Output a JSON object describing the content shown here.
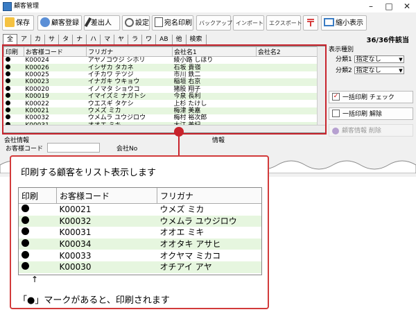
{
  "window": {
    "title": "顧客管理"
  },
  "toolbar": {
    "save": "保存",
    "register": "顧客登録",
    "sender": "差出人",
    "settings": "設定",
    "address_print": "宛名印刷",
    "backup": "バックアップ",
    "import": "インポート",
    "export": "エクスポート",
    "shrink": "縮小表示"
  },
  "kana_tabs": [
    "全",
    "ア",
    "カ",
    "サ",
    "タ",
    "ナ",
    "ハ",
    "マ",
    "ヤ",
    "ラ",
    "ワ",
    "AB",
    "他",
    "検索"
  ],
  "count_label": "36/36件該当",
  "grid": {
    "columns": [
      "印刷",
      "お客様コード",
      "フリガナ",
      "",
      "会社名1",
      "会社名2"
    ],
    "rows": [
      {
        "code": "K00024",
        "kana": "アヤノコウジ シホリ",
        "company": "綾小路 しほり"
      },
      {
        "code": "K00026",
        "kana": "イシザカ タカネ",
        "company": "石坂 貴嶺"
      },
      {
        "code": "K00025",
        "kana": "イチカワ テツジ",
        "company": "市川 鉄二"
      },
      {
        "code": "K00023",
        "kana": "イナガキ ウキョウ",
        "company": "稲垣 右京"
      },
      {
        "code": "K00020",
        "kana": "イノマタ ショウコ",
        "company": "猪股 翔子"
      },
      {
        "code": "K00019",
        "kana": "イマイズミ ナガトシ",
        "company": "今泉 長利"
      },
      {
        "code": "K00022",
        "kana": "ウエスギ タケシ",
        "company": "上杉 たけし"
      },
      {
        "code": "K00021",
        "kana": "ウメズ ミカ",
        "company": "梅津 美嘉"
      },
      {
        "code": "K00032",
        "kana": "ウメムラ ユウジロウ",
        "company": "梅村 裕次郎"
      },
      {
        "code": "K00031",
        "kana": "オオエ ミキ",
        "company": "大江 美紀"
      }
    ]
  },
  "side": {
    "display_type": "表示種別",
    "class1_label": "分類1",
    "class1_value": "指定なし",
    "class2_label": "分類2",
    "class2_value": "指定なし",
    "bulk_print_check": "一括印刷 チェック",
    "bulk_print_clear": "一括印刷 解除",
    "customer_info_clear": "顧客情報 削除"
  },
  "lower": {
    "company_info": "会社情報",
    "customer_code": "お客様コード",
    "company_no": "会社No",
    "info": "情報"
  },
  "callout": {
    "heading": "印刷する顧客をリスト表示します",
    "columns": [
      "印刷",
      "お客様コード",
      "フリガナ"
    ],
    "rows": [
      {
        "code": "K00021",
        "kana": "ウメズ ミカ"
      },
      {
        "code": "K00032",
        "kana": "ウメムラ ユウジロウ"
      },
      {
        "code": "K00031",
        "kana": "オオエ ミキ"
      },
      {
        "code": "K00034",
        "kana": "オオタキ アサヒ"
      },
      {
        "code": "K00033",
        "kana": "オクヤマ ミカコ"
      },
      {
        "code": "K00030",
        "kana": "オチアイ アヤ"
      }
    ],
    "arrow": "↑",
    "footnote": "「●」マークがあると、印刷されます"
  },
  "colors": {
    "accent_red": "#c8232c",
    "row_alt": "#e6f6df"
  }
}
